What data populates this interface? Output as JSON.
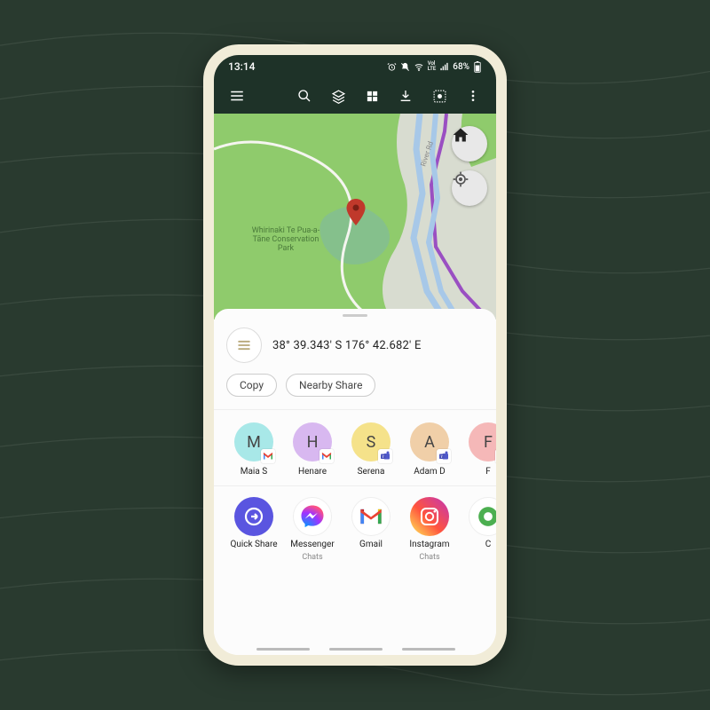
{
  "status": {
    "time": "13:14",
    "battery": "68%",
    "lte": "LTE",
    "vol": "Vol"
  },
  "map": {
    "park_label": "Whirinaki Te Pua-a-Tāne Conservation Park",
    "road_label": "River Rd"
  },
  "sheet": {
    "coordinates": "38° 39.343' S  176° 42.682' E",
    "copy_label": "Copy",
    "nearby_label": "Nearby Share"
  },
  "contacts": [
    {
      "initial": "M",
      "name": "Maia S",
      "color": "#a8e8e8",
      "via": "gmail"
    },
    {
      "initial": "H",
      "name": "Henare",
      "color": "#d8b8f0",
      "via": "gmail"
    },
    {
      "initial": "S",
      "name": "Serena",
      "color": "#f5e28a",
      "via": "teams"
    },
    {
      "initial": "A",
      "name": "Adam D",
      "color": "#f0cfa8",
      "via": "teams"
    },
    {
      "initial": "F",
      "name": "F",
      "color": "#f5b8b8",
      "via": "teams"
    }
  ],
  "apps": [
    {
      "name": "Quick Share",
      "sub": "",
      "icon": "quickshare"
    },
    {
      "name": "Messenger",
      "sub": "Chats",
      "icon": "messenger"
    },
    {
      "name": "Gmail",
      "sub": "",
      "icon": "gmail"
    },
    {
      "name": "Instagram",
      "sub": "Chats",
      "icon": "instagram"
    },
    {
      "name": "C",
      "sub": "",
      "icon": "chrome"
    }
  ]
}
